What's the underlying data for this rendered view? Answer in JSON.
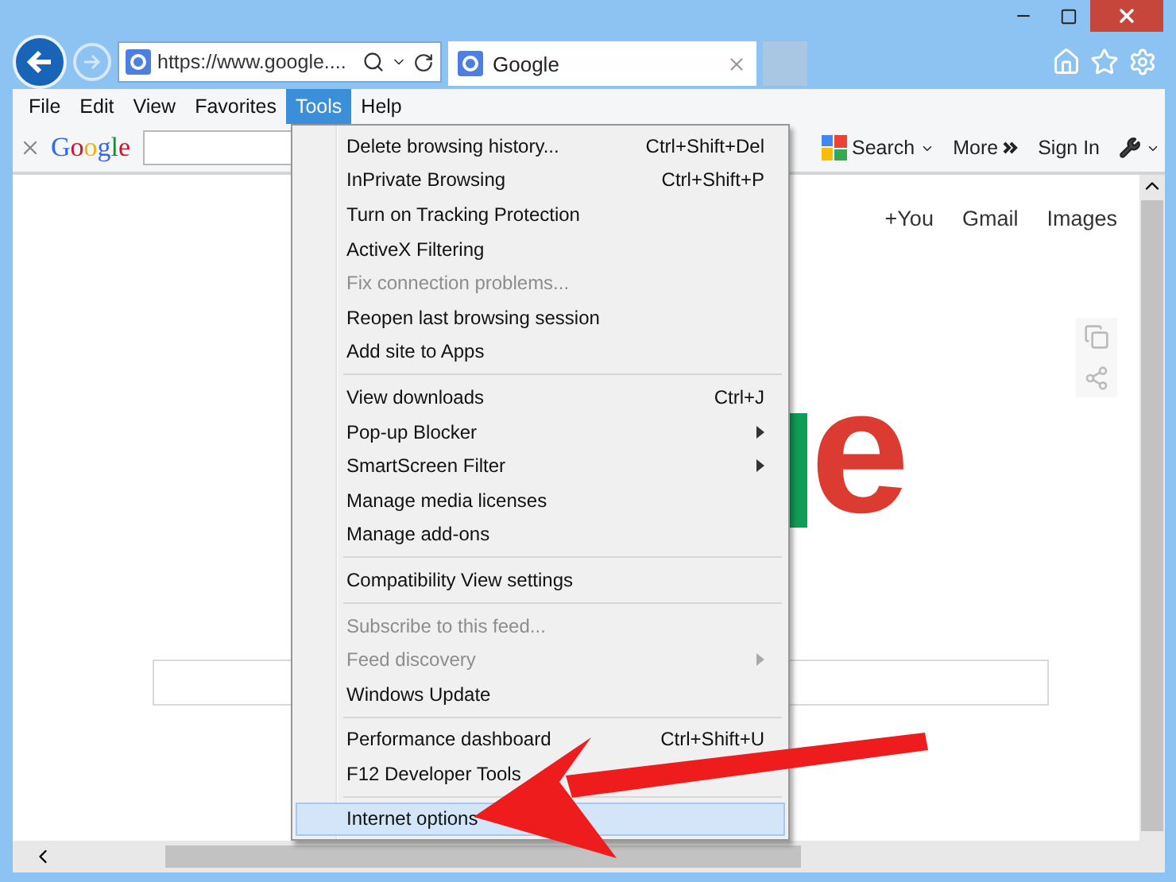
{
  "address_bar": {
    "url": "https://www.google...."
  },
  "tabs": [
    {
      "title": "Google",
      "selected": true
    }
  ],
  "menu_bar": [
    {
      "label": "File",
      "selected": false
    },
    {
      "label": "Edit",
      "selected": false
    },
    {
      "label": "View",
      "selected": false
    },
    {
      "label": "Favorites",
      "selected": false
    },
    {
      "label": "Tools",
      "selected": true
    },
    {
      "label": "Help",
      "selected": false
    }
  ],
  "toolbar": {
    "logo": [
      {
        "text": "G",
        "color": "#3369e8"
      },
      {
        "text": "o",
        "color": "#d50f25"
      },
      {
        "text": "o",
        "color": "#eeb211"
      },
      {
        "text": "g",
        "color": "#3369e8"
      },
      {
        "text": "l",
        "color": "#009925"
      },
      {
        "text": "e",
        "color": "#d50f25"
      }
    ],
    "search_label": "Search",
    "more_label": "More",
    "signin_label": "Sign In"
  },
  "page": {
    "links": [
      "+You",
      "Gmail",
      "Images"
    ],
    "logo": [
      {
        "text": "e",
        "color": "#db3b31"
      }
    ]
  },
  "tools_menu": [
    {
      "group": [
        {
          "label": "Delete browsing history...",
          "shortcut": "Ctrl+Shift+Del",
          "disabled": false,
          "submenu": false,
          "selected": false
        },
        {
          "label": "InPrivate Browsing",
          "shortcut": "Ctrl+Shift+P",
          "disabled": false,
          "submenu": false,
          "selected": false
        },
        {
          "label": "Turn on Tracking Protection",
          "disabled": false,
          "submenu": false,
          "selected": false
        },
        {
          "label": "ActiveX Filtering",
          "disabled": false,
          "submenu": false,
          "selected": false
        },
        {
          "label": "Fix connection problems...",
          "disabled": true,
          "submenu": false,
          "selected": false
        },
        {
          "label": "Reopen last browsing session",
          "disabled": false,
          "submenu": false,
          "selected": false
        },
        {
          "label": "Add site to Apps",
          "disabled": false,
          "submenu": false,
          "selected": false
        }
      ]
    },
    {
      "group": [
        {
          "label": "View downloads",
          "shortcut": "Ctrl+J",
          "disabled": false,
          "submenu": false,
          "selected": false
        },
        {
          "label": "Pop-up Blocker",
          "disabled": false,
          "submenu": true,
          "selected": false
        },
        {
          "label": "SmartScreen Filter",
          "disabled": false,
          "submenu": true,
          "selected": false
        },
        {
          "label": "Manage media licenses",
          "disabled": false,
          "submenu": false,
          "selected": false
        },
        {
          "label": "Manage add-ons",
          "disabled": false,
          "submenu": false,
          "selected": false
        }
      ]
    },
    {
      "group": [
        {
          "label": "Compatibility View settings",
          "disabled": false,
          "submenu": false,
          "selected": false
        }
      ]
    },
    {
      "group": [
        {
          "label": "Subscribe to this feed...",
          "disabled": true,
          "submenu": false,
          "selected": false
        },
        {
          "label": "Feed discovery",
          "disabled": true,
          "submenu": true,
          "selected": false
        },
        {
          "label": "Windows Update",
          "disabled": false,
          "submenu": false,
          "selected": false
        }
      ]
    },
    {
      "group": [
        {
          "label": "Performance dashboard",
          "shortcut": "Ctrl+Shift+U",
          "disabled": false,
          "submenu": false,
          "selected": false
        },
        {
          "label": "F12 Developer Tools",
          "disabled": false,
          "submenu": false,
          "selected": false
        }
      ]
    },
    {
      "group": [
        {
          "label": "Internet options",
          "disabled": false,
          "submenu": false,
          "selected": true
        }
      ]
    }
  ]
}
